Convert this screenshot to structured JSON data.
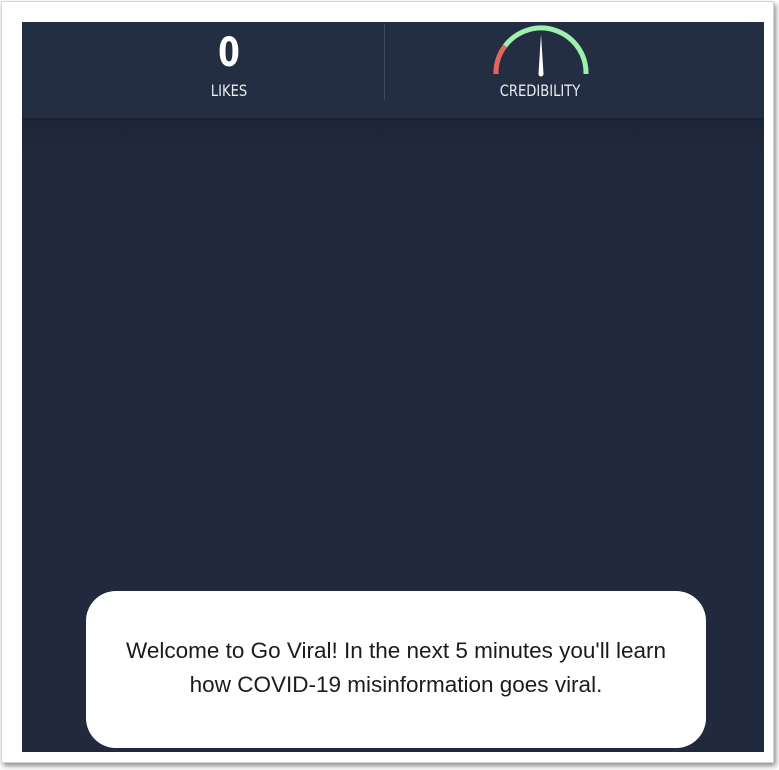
{
  "stats": {
    "likes_value": "0",
    "likes_label": "LIKES",
    "credibility_label": "CREDIBILITY",
    "credibility_level": 0.5
  },
  "gauge": {
    "colors": {
      "low": "#e2675c",
      "high": "#9ef0ac",
      "needle": "#ffffff"
    }
  },
  "dialog": {
    "message": "Welcome to Go Viral! In the next 5 minutes you'll learn how COVID-19 misinformation goes viral."
  },
  "colors": {
    "background": "#212a3d",
    "topbar": "#242e42",
    "dialog": "#ffffff"
  }
}
